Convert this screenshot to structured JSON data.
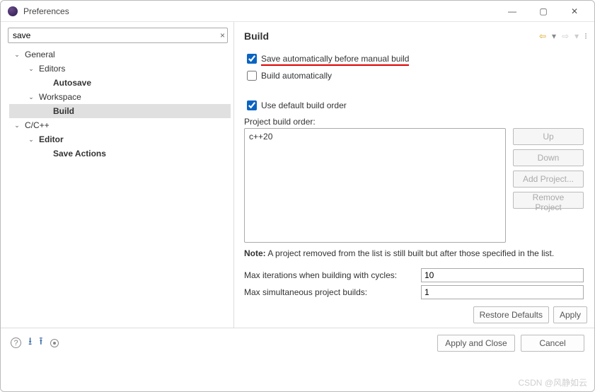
{
  "window": {
    "title": "Preferences"
  },
  "search": {
    "value": "save",
    "clear_glyph": "×"
  },
  "tree": {
    "nodes": [
      {
        "depth": 0,
        "label": "General",
        "expanded": true,
        "bold": false,
        "selected": false
      },
      {
        "depth": 1,
        "label": "Editors",
        "expanded": true,
        "bold": false,
        "selected": false
      },
      {
        "depth": 2,
        "label": "Autosave",
        "expanded": false,
        "bold": true,
        "selected": false,
        "leaf": true
      },
      {
        "depth": 1,
        "label": "Workspace",
        "expanded": true,
        "bold": false,
        "selected": false
      },
      {
        "depth": 2,
        "label": "Build",
        "expanded": false,
        "bold": true,
        "selected": true,
        "leaf": true
      },
      {
        "depth": 0,
        "label": "C/C++",
        "expanded": true,
        "bold": false,
        "selected": false
      },
      {
        "depth": 1,
        "label": "Editor",
        "expanded": true,
        "bold": true,
        "selected": false
      },
      {
        "depth": 2,
        "label": "Save Actions",
        "expanded": false,
        "bold": true,
        "selected": false,
        "leaf": true
      }
    ]
  },
  "pane": {
    "heading": "Build",
    "save_auto": {
      "label": "Save automatically before manual build",
      "checked": true,
      "highlighted": true
    },
    "build_auto": {
      "label": "Build automatically",
      "checked": false
    },
    "use_default_order": {
      "label": "Use default build order",
      "checked": true
    },
    "order_label": "Project build order:",
    "order_items": [
      "c++20"
    ],
    "buttons": {
      "up": "Up",
      "down": "Down",
      "add": "Add Project...",
      "remove": "Remove Project"
    },
    "note_prefix": "Note:",
    "note_text": " A project removed from the list is still built but after those specified in the list.",
    "max_iter": {
      "label": "Max iterations when building with cycles:",
      "value": "10"
    },
    "max_sim": {
      "label": "Max simultaneous project builds:",
      "value": "1"
    },
    "restore_defaults": "Restore Defaults",
    "apply": "Apply"
  },
  "footer": {
    "apply_close": "Apply and Close",
    "cancel": "Cancel"
  },
  "watermark": "CSDN @风静如云"
}
